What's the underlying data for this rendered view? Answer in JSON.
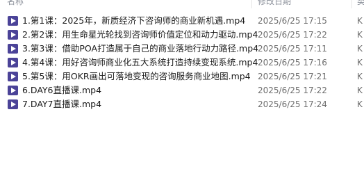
{
  "columns": {
    "name": "名称",
    "date": "修改日期",
    "type": "类"
  },
  "files": [
    {
      "icon": "video-file-icon",
      "name": "1.第1课：2025年，新质经济下咨询师的商业新机遇.mp4",
      "date": "2025/6/25 17:15",
      "type": "K"
    },
    {
      "icon": "video-file-icon",
      "name": "2.第2课：用生命星光轮找到咨询师价值定位和动力驱动.mp4",
      "date": "2025/6/25 17:22",
      "type": "K"
    },
    {
      "icon": "video-file-icon",
      "name": "3.第3课：借助POA打造属于自己的商业落地行动力路径.mp4",
      "date": "2025/6/25 17:11",
      "type": "K"
    },
    {
      "icon": "video-file-icon",
      "name": "4.第4课：用好咨询师商业化五大系统打造持续变现系统.mp4",
      "date": "2025/6/25 17:16",
      "type": "K"
    },
    {
      "icon": "video-file-icon",
      "name": "5.第5课：用OKR画出可落地变现的咨询服务商业地图.mp4",
      "date": "2025/6/25 17:21",
      "type": "K"
    },
    {
      "icon": "video-file-icon",
      "name": "6.DAY6直播课.mp4",
      "date": "2025/6/25 17:22",
      "type": "K"
    },
    {
      "icon": "video-file-icon",
      "name": "7.DAY7直播课.mp4",
      "date": "2025/6/25 17:24",
      "type": "K"
    }
  ],
  "colors": {
    "icon_bg": "#4b4398",
    "header_text": "#8a8f99",
    "name_text": "#1a1a1a",
    "meta_text": "#6d6d6d"
  }
}
